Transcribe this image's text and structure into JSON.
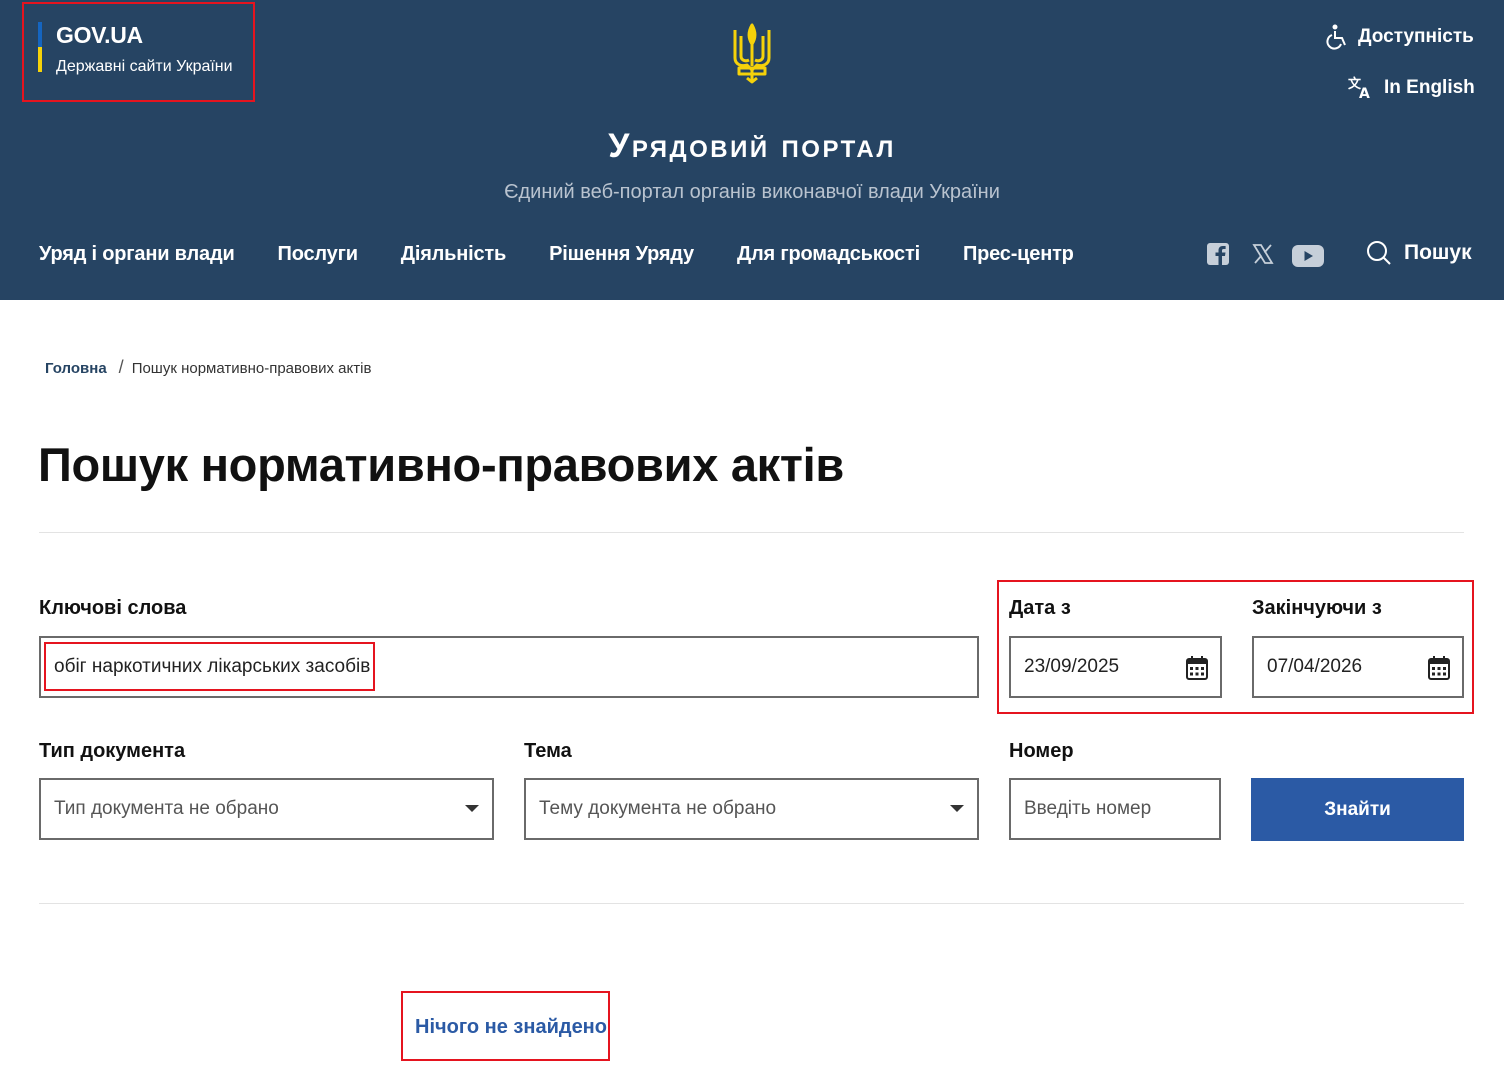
{
  "header": {
    "govua_title": "GOV.UA",
    "govua_subtitle": "Державні сайти України",
    "accessibility_label": "Доступність",
    "language_label": "In English",
    "portal_title": "Урядовий портал",
    "portal_subtitle": "Єдиний веб-портал органів виконавчої влади України",
    "nav": [
      {
        "label": "Уряд і органи влади"
      },
      {
        "label": "Послуги"
      },
      {
        "label": "Діяльність"
      },
      {
        "label": "Рішення Уряду"
      },
      {
        "label": "Для громадськості"
      },
      {
        "label": "Прес-центр"
      }
    ],
    "search_label": "Пошук"
  },
  "breadcrumb": {
    "home": "Головна",
    "separator": "/",
    "current": "Пошук нормативно-правових актів"
  },
  "page": {
    "title": "Пошук нормативно-правових актів"
  },
  "form": {
    "keywords_label": "Ключові слова",
    "keywords_value": "обіг наркотичних лікарських засобів",
    "date_from_label": "Дата з",
    "date_from_value": "23/09/2025",
    "date_to_label": "Закінчуючи з",
    "date_to_value": "07/04/2026",
    "doc_type_label": "Тип документа",
    "doc_type_value": "Тип документа не обрано",
    "topic_label": "Тема",
    "topic_value": "Тему документа не обрано",
    "number_label": "Номер",
    "number_placeholder": "Введіть номер",
    "find_button": "Знайти"
  },
  "results": {
    "empty_message": "Нічого не знайдено"
  },
  "colors": {
    "header_bg": "#264463",
    "button_bg": "#2b5aa5",
    "link": "#2b5aa5",
    "highlight_box": "#e5141f",
    "trident": "#f5d20a"
  }
}
